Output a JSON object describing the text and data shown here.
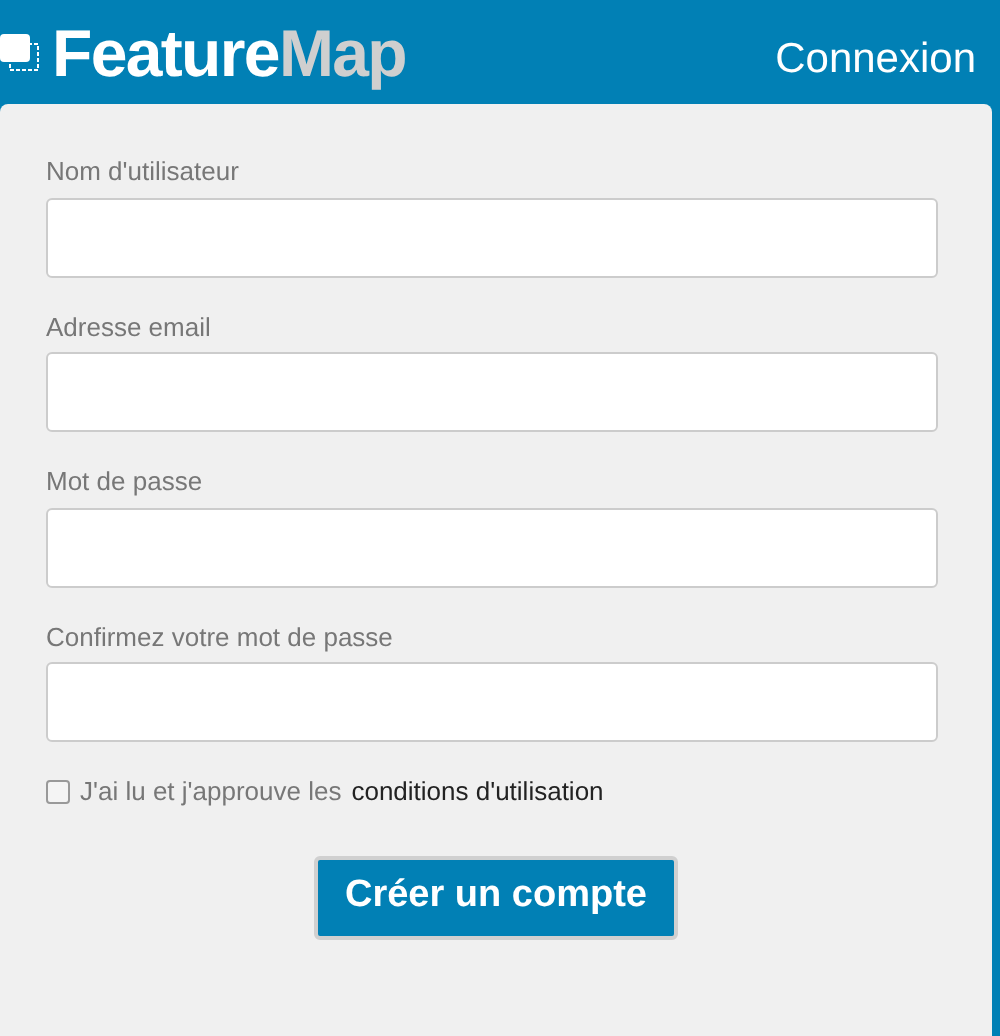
{
  "header": {
    "logo": {
      "part_1": "Feature",
      "part_2": "Map"
    },
    "login_link": "Connexion"
  },
  "form": {
    "fields": [
      {
        "label": "Nom d'utilisateur"
      },
      {
        "label": "Adresse email"
      },
      {
        "label": "Mot de passe"
      },
      {
        "label": "Confirmez votre mot de passe"
      }
    ],
    "terms": {
      "checked": false,
      "text": "J'ai lu et j'approuve les",
      "link": "conditions d'utilisation"
    },
    "submit": "Créer un compte"
  }
}
